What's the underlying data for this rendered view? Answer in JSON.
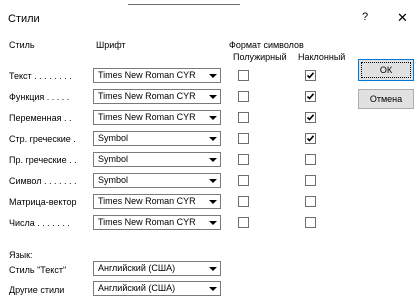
{
  "window": {
    "title": "Стили",
    "help_glyph": "?",
    "close_glyph": "✕"
  },
  "headers": {
    "style": "Стиль",
    "font": "Шрифт",
    "format": "Формат символов",
    "bold": "Полужирный",
    "italic": "Наклонный"
  },
  "rows": [
    {
      "label": "Текст . . . . . . . .",
      "font": "Times New Roman CYR",
      "bold": false,
      "italic": true
    },
    {
      "label": "Функция  . . . . .",
      "font": "Times New Roman CYR",
      "bold": false,
      "italic": true
    },
    {
      "label": "Переменная . .",
      "font": "Times New Roman CYR",
      "bold": false,
      "italic": true
    },
    {
      "label": "Стр. греческие .",
      "font": "Symbol",
      "bold": false,
      "italic": true
    },
    {
      "label": "Пр. греческие . .",
      "font": "Symbol",
      "bold": false,
      "italic": false
    },
    {
      "label": "Символ . . . . . . .",
      "font": "Symbol",
      "bold": false,
      "italic": false
    },
    {
      "label": "Матрица-вектор",
      "font": "Times New Roman CYR",
      "bold": false,
      "italic": false
    },
    {
      "label": "Числа . . . . . . .",
      "font": "Times New Roman CYR",
      "bold": false,
      "italic": false
    }
  ],
  "language": {
    "heading": "Язык:",
    "text_style_label": "Стиль \"Текст\"",
    "text_style_value": "Английский (США)",
    "other_label": "Другие стили",
    "other_value": "Английский (США)"
  },
  "buttons": {
    "ok": "ОК",
    "cancel": "Отмена"
  }
}
